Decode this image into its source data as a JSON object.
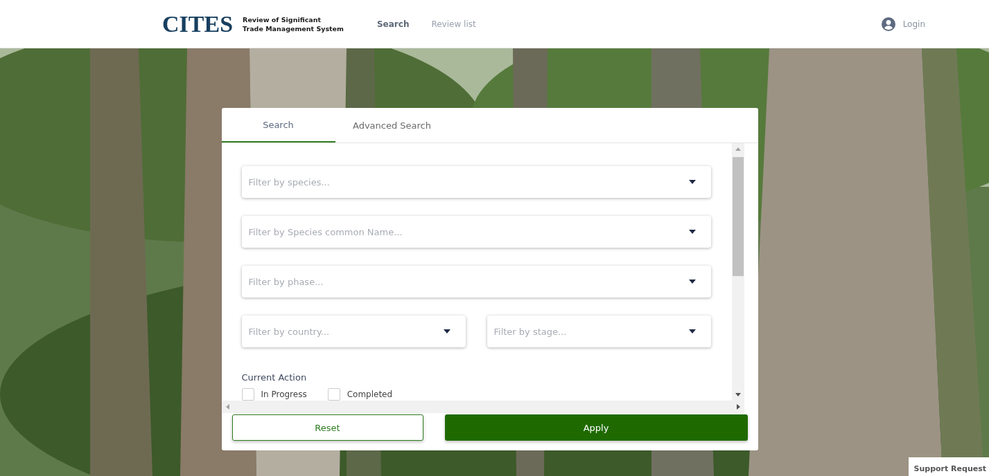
{
  "header": {
    "logo": "CITES",
    "app_title": [
      "Review of Significant",
      "Trade Management System"
    ],
    "nav": [
      {
        "label": "Search",
        "selected": true
      },
      {
        "label": "Review list",
        "selected": false
      }
    ],
    "login": "Login"
  },
  "panel": {
    "tabs": [
      {
        "label": "Search",
        "selected": true
      },
      {
        "label": "Advanced Search",
        "selected": false
      }
    ],
    "filters": [
      {
        "placeholder": "Filter by species...",
        "kind": "full"
      },
      {
        "placeholder": "Filter by Species common Name...",
        "kind": "full"
      },
      {
        "placeholder": "Filter by phase...",
        "kind": "full"
      },
      {
        "placeholder": "Filter by country...",
        "kind": "half"
      },
      {
        "placeholder": "Filter by stage...",
        "kind": "half"
      }
    ],
    "section_title": "Current Action",
    "checkboxes": [
      {
        "label": "In Progress",
        "checked": false
      },
      {
        "label": "Completed",
        "checked": false
      }
    ],
    "buttons": [
      {
        "label": "Reset",
        "kind": "secondary"
      },
      {
        "label": "Apply",
        "kind": "primary"
      }
    ]
  },
  "support_request": "Support Request"
}
